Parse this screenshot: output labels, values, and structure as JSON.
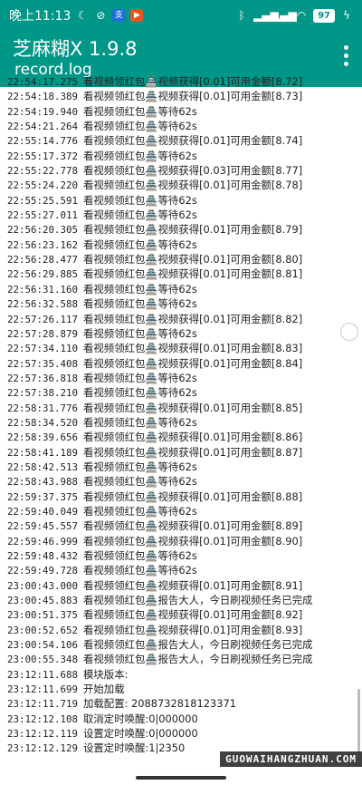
{
  "status_bar": {
    "time": "晚上11:13",
    "battery": "97",
    "accent": "#009688"
  },
  "app_bar": {
    "title": "芝麻糊X 1.9.8",
    "subtitle": "record.log"
  },
  "log_lines": [
    {
      "time": "22:54:17.275",
      "msg": "看视频领红包🏯视频获得[0.01]可用金额[8.72]"
    },
    {
      "time": "22:54:18.389",
      "msg": "看视频领红包🏯视频获得[0.01]可用金额[8.73]"
    },
    {
      "time": "22:54:19.940",
      "msg": "看视频领红包🏯等待62s"
    },
    {
      "time": "22:54:21.264",
      "msg": "看视频领红包🏯等待62s"
    },
    {
      "time": "22:55:14.776",
      "msg": "看视频领红包🏯视频获得[0.01]可用金额[8.74]"
    },
    {
      "time": "22:55:17.372",
      "msg": "看视频领红包🏯等待62s"
    },
    {
      "time": "22:55:22.778",
      "msg": "看视频领红包🏯视频获得[0.03]可用金额[8.77]"
    },
    {
      "time": "22:55:24.220",
      "msg": "看视频领红包🏯视频获得[0.01]可用金额[8.78]"
    },
    {
      "time": "22:55:25.591",
      "msg": "看视频领红包🏯等待62s"
    },
    {
      "time": "22:55:27.011",
      "msg": "看视频领红包🏯等待62s"
    },
    {
      "time": "22:56:20.305",
      "msg": "看视频领红包🏯视频获得[0.01]可用金额[8.79]"
    },
    {
      "time": "22:56:23.162",
      "msg": "看视频领红包🏯等待62s"
    },
    {
      "time": "22:56:28.477",
      "msg": "看视频领红包🏯视频获得[0.01]可用金额[8.80]"
    },
    {
      "time": "22:56:29.885",
      "msg": "看视频领红包🏯视频获得[0.01]可用金额[8.81]"
    },
    {
      "time": "22:56:31.160",
      "msg": "看视频领红包🏯等待62s"
    },
    {
      "time": "22:56:32.588",
      "msg": "看视频领红包🏯等待62s"
    },
    {
      "time": "22:57:26.117",
      "msg": "看视频领红包🏯视频获得[0.01]可用金额[8.82]"
    },
    {
      "time": "22:57:28.879",
      "msg": "看视频领红包🏯等待62s"
    },
    {
      "time": "22:57:34.110",
      "msg": "看视频领红包🏯视频获得[0.01]可用金额[8.83]"
    },
    {
      "time": "22:57:35.408",
      "msg": "看视频领红包🏯视频获得[0.01]可用金额[8.84]"
    },
    {
      "time": "22:57:36.818",
      "msg": "看视频领红包🏯等待62s"
    },
    {
      "time": "22:57:38.210",
      "msg": "看视频领红包🏯等待62s"
    },
    {
      "time": "22:58:31.776",
      "msg": "看视频领红包🏯视频获得[0.01]可用金额[8.85]"
    },
    {
      "time": "22:58:34.520",
      "msg": "看视频领红包🏯等待62s"
    },
    {
      "time": "22:58:39.656",
      "msg": "看视频领红包🏯视频获得[0.01]可用金额[8.86]"
    },
    {
      "time": "22:58:41.189",
      "msg": "看视频领红包🏯视频获得[0.01]可用金额[8.87]"
    },
    {
      "time": "22:58:42.513",
      "msg": "看视频领红包🏯等待62s"
    },
    {
      "time": "22:58:43.988",
      "msg": "看视频领红包🏯等待62s"
    },
    {
      "time": "22:59:37.375",
      "msg": "看视频领红包🏯视频获得[0.01]可用金额[8.88]"
    },
    {
      "time": "22:59:40.049",
      "msg": "看视频领红包🏯等待62s"
    },
    {
      "time": "22:59:45.557",
      "msg": "看视频领红包🏯视频获得[0.01]可用金额[8.89]"
    },
    {
      "time": "22:59:46.999",
      "msg": "看视频领红包🏯视频获得[0.01]可用金额[8.90]"
    },
    {
      "time": "22:59:48.432",
      "msg": "看视频领红包🏯等待62s"
    },
    {
      "time": "22:59:49.728",
      "msg": "看视频领红包🏯等待62s"
    },
    {
      "time": "23:00:43.000",
      "msg": "看视频领红包🏯视频获得[0.01]可用金额[8.91]"
    },
    {
      "time": "23:00:45.883",
      "msg": "看视频领红包🏯报告大人，今日刷视频任务已完成"
    },
    {
      "time": "23:00:51.375",
      "msg": "看视频领红包🏯视频获得[0.01]可用金额[8.92]"
    },
    {
      "time": "23:00:52.652",
      "msg": "看视频领红包🏯视频获得[0.01]可用金额[8.93]"
    },
    {
      "time": "23:00:54.106",
      "msg": "看视频领红包🏯报告大人，今日刷视频任务已完成"
    },
    {
      "time": "23:00:55.348",
      "msg": "看视频领红包🏯报告大人，今日刷视频任务已完成"
    },
    {
      "time": "23:12:11.688",
      "msg": "模块版本:"
    },
    {
      "time": "23:12:11.699",
      "msg": "开始加载"
    },
    {
      "time": "23:12:11.719",
      "msg": "加载配置: 2088732818123371"
    },
    {
      "time": "23:12:12.108",
      "msg": "取消定时唤醒:0|000000"
    },
    {
      "time": "23:12:12.119",
      "msg": "设置定时唤醒:0|000000"
    },
    {
      "time": "23:12:12.129",
      "msg": "设置定时唤醒:1|2350"
    }
  ],
  "watermark": "GUOWAIHANGZHUAN.COM"
}
